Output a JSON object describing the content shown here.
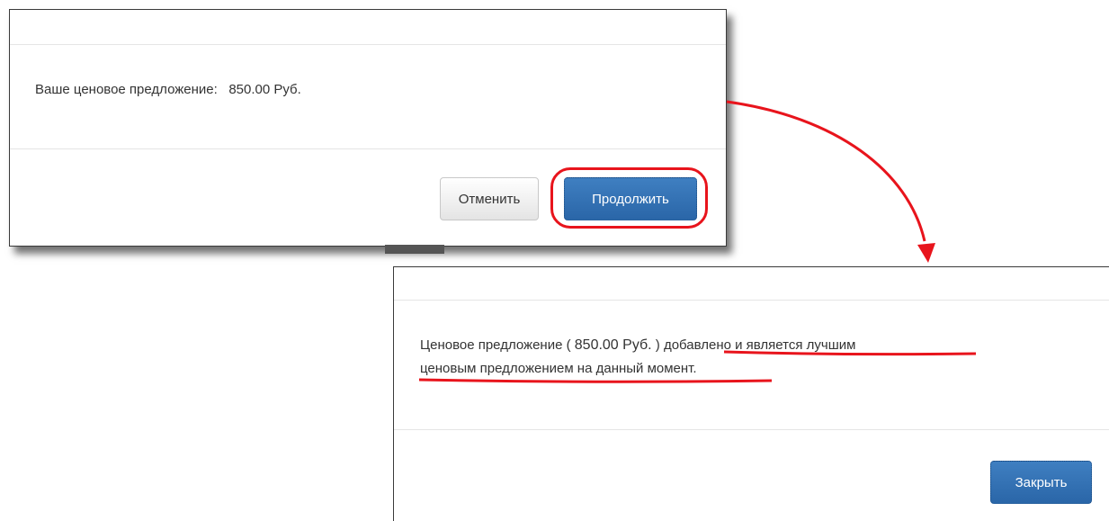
{
  "offer_dialog": {
    "label": "Ваше ценовое предложение:",
    "amount": "850.00 Руб.",
    "cancel_button": "Отменить",
    "continue_button": "Продолжить"
  },
  "confirmation_dialog": {
    "prefix": "Ценовое предложение (",
    "amount": "850.00 Руб.",
    "suffix_part1": ") добавлено и является лучшим",
    "suffix_part2": "ценовым предложением на данный момент",
    "period": ".",
    "close_button": "Закрыть"
  },
  "colors": {
    "primary_button": "#337ab7",
    "annotation_red": "#e8141c",
    "divider": "#e5e5e5"
  }
}
